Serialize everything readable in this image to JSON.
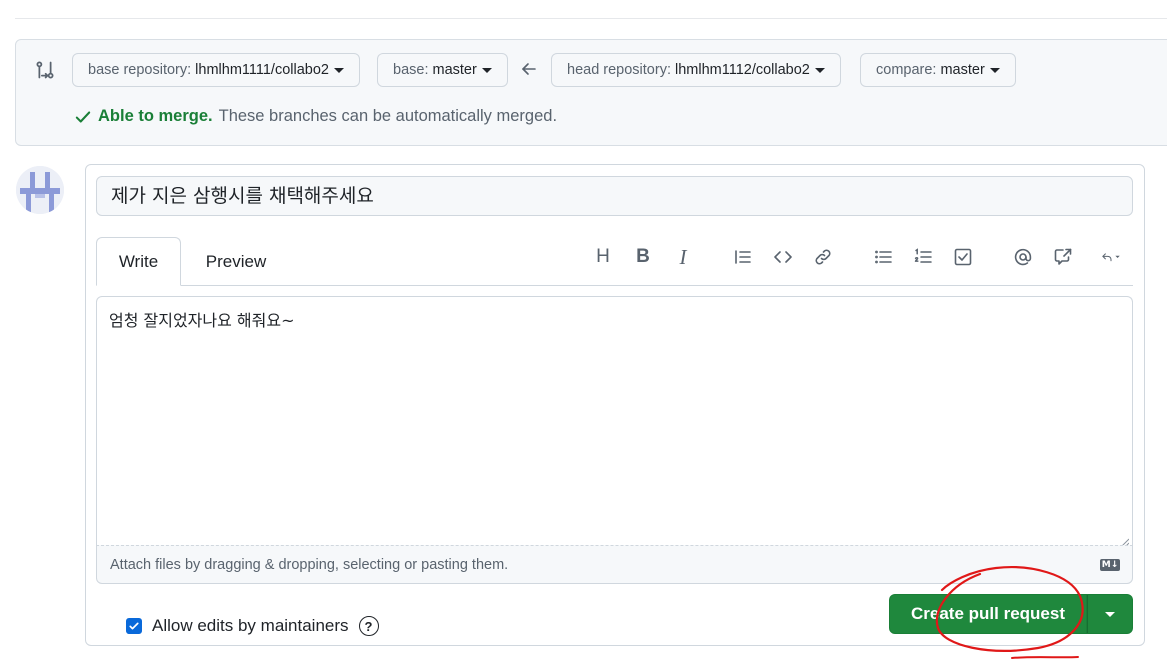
{
  "compare": {
    "base_repo_label": "base repository:",
    "base_repo_value": "lhmlhm1111/collabo2",
    "base_label": "base:",
    "base_value": "master",
    "head_repo_label": "head repository:",
    "head_repo_value": "lhmlhm1112/collabo2",
    "compare_label": "compare:",
    "compare_value": "master",
    "merge_status": "Able to merge.",
    "merge_message": "These branches can be automatically merged."
  },
  "composer": {
    "title_value": "제가 지은 삼행시를 채택해주세요",
    "tabs": [
      {
        "label": "Write"
      },
      {
        "label": "Preview"
      }
    ],
    "body_value": "엄청 잘지었자나요 해줘요~",
    "attach_hint": "Attach files by dragging & dropping, selecting or pasting them.",
    "markdown_badge": "M↓",
    "toolbar": {
      "heading": "H",
      "bold": "B",
      "italic": "I"
    },
    "allow_edits_label": "Allow edits by maintainers",
    "help": "?",
    "create_label": "Create pull request"
  },
  "colors": {
    "accent_green": "#1f883d",
    "merge_green": "#1a7f37",
    "checkbox_blue": "#0969da",
    "annotation_red": "#e01818"
  }
}
